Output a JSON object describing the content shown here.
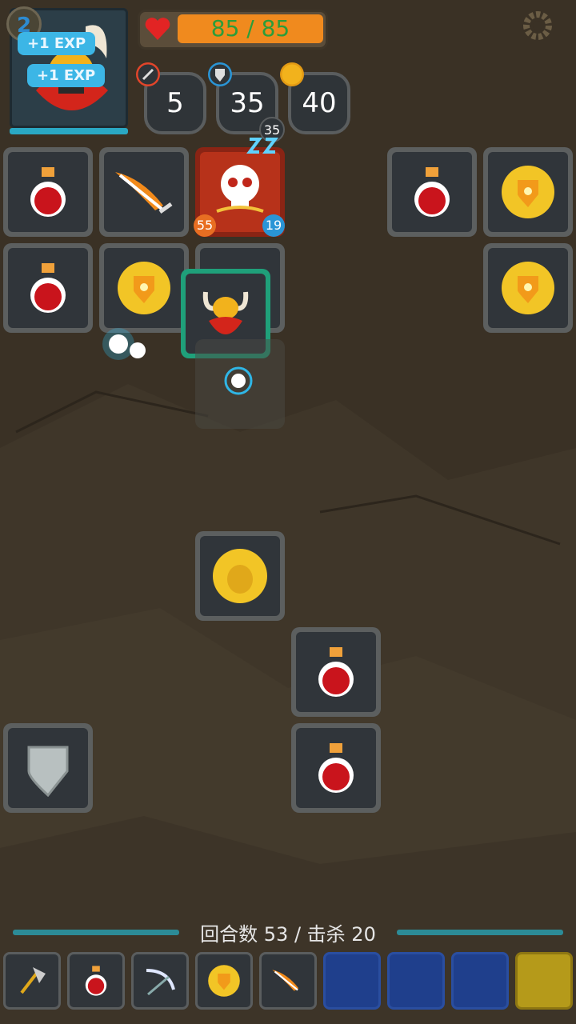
{
  "header": {
    "level": "2",
    "exp_popups": [
      "+1 EXP",
      "+1 EXP"
    ],
    "hp_text": "85 / 85",
    "stats": {
      "attack": "5",
      "defense": "35",
      "gold": "40"
    }
  },
  "enemy": {
    "attack": "55",
    "defense": "19",
    "sleep_value": "35",
    "sleep_icon": "zzz-icon"
  },
  "board": {
    "tiles": [
      {
        "icon": "potion-icon"
      },
      {
        "icon": "flame-sword-icon"
      },
      {
        "icon": "skull-enemy"
      },
      {
        "icon": "potion-icon"
      },
      {
        "icon": "gold-shield-coin-icon"
      },
      {
        "icon": "potion-icon"
      },
      {
        "icon": "gold-shield-coin-icon"
      },
      {
        "icon": "hero-viking"
      },
      {
        "icon": "gold-shield-coin-icon"
      },
      {
        "icon": "gold-viking-coin-icon"
      },
      {
        "icon": "potion-icon"
      },
      {
        "icon": "potion-icon"
      },
      {
        "icon": "shield-icon"
      }
    ]
  },
  "footer": {
    "turns_text": "回合数 53 / 击杀 20",
    "slots": [
      "axe-icon",
      "potion-icon",
      "scythe-icon",
      "gold-shield-coin-icon",
      "flame-sword-icon",
      "empty-slot",
      "empty-slot",
      "empty-slot",
      "gold-empty-slot"
    ]
  },
  "colors": {
    "hp_fill": "#f08a1e",
    "hp_text": "#2b9d3a",
    "hero_frame": "#1fa07a",
    "enemy_bg": "#b7321a",
    "empty_slot": "#1f3f8c"
  }
}
